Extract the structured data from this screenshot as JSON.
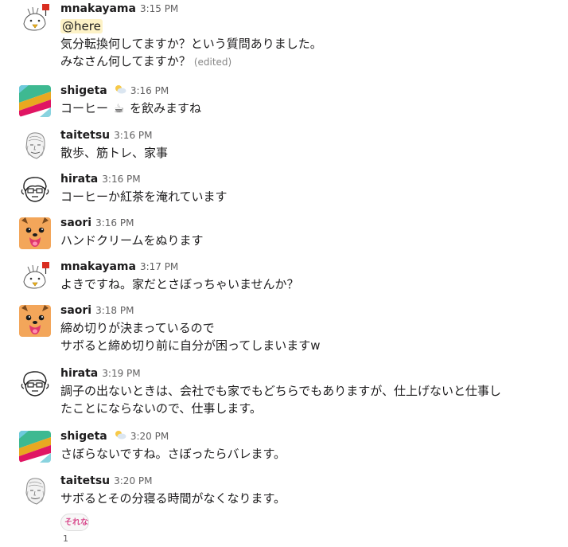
{
  "messages": [
    {
      "author": "mnakayama",
      "time": "3:15 PM",
      "mention": "@here",
      "lines": [
        "気分転換何してますか？という質問ありました。",
        "みなさん何してますか？"
      ],
      "edited": "(edited)"
    },
    {
      "author": "shigeta",
      "status_icon": "sun-behind-cloud",
      "time": "3:16 PM",
      "text_before": "コーヒー",
      "emoji": "☕",
      "text_after": "を飲みますね"
    },
    {
      "author": "taitetsu",
      "time": "3:16 PM",
      "lines": [
        "散歩、筋トレ、家事"
      ]
    },
    {
      "author": "hirata",
      "time": "3:16 PM",
      "lines": [
        "コーヒーか紅茶を淹れています"
      ]
    },
    {
      "author": "saori",
      "time": "3:16 PM",
      "lines": [
        "ハンドクリームをぬります"
      ]
    },
    {
      "author": "mnakayama",
      "time": "3:17 PM",
      "lines": [
        "よきですね。家だとさぼっちゃいませんか？"
      ]
    },
    {
      "author": "saori",
      "time": "3:18 PM",
      "lines": [
        "締め切りが決まっているので",
        "サボると締め切り前に自分が困ってしまいますw"
      ]
    },
    {
      "author": "hirata",
      "time": "3:19 PM",
      "lines": [
        "調子の出ないときは、会社でも家でもどちらでもありますが、仕上げないと仕事し",
        "たことにならないので、仕事します。"
      ]
    },
    {
      "author": "shigeta",
      "status_icon": "sun-behind-cloud",
      "time": "3:20 PM",
      "lines": [
        "さぼらないですね。さぼったらバレます。"
      ]
    },
    {
      "author": "taitetsu",
      "time": "3:20 PM",
      "lines": [
        "サボるとその分寝る時間がなくなります。"
      ],
      "reaction": {
        "emoji": "それな",
        "count": "1"
      }
    }
  ]
}
